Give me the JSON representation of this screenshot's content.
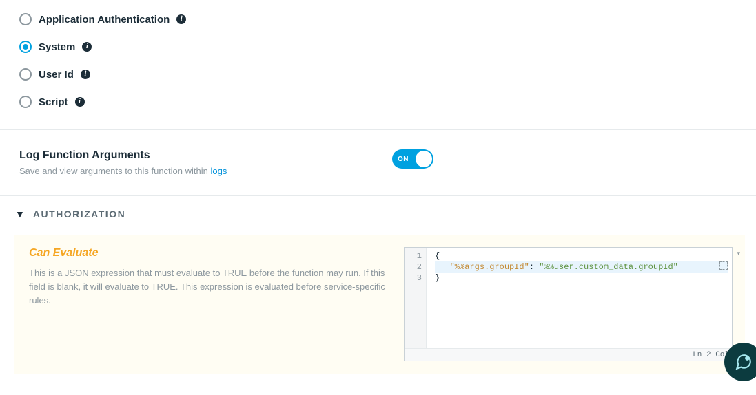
{
  "radios": {
    "items": [
      {
        "label": "Application Authentication",
        "selected": false
      },
      {
        "label": "System",
        "selected": true
      },
      {
        "label": "User Id",
        "selected": false
      },
      {
        "label": "Script",
        "selected": false
      }
    ]
  },
  "log_args": {
    "title": "Log Function Arguments",
    "desc_prefix": "Save and view arguments to this function within ",
    "link": "logs",
    "toggle_label": "ON",
    "enabled": true
  },
  "auth": {
    "header": "AUTHORIZATION",
    "panel_title": "Can Evaluate",
    "panel_desc": "This is a JSON expression that must evaluate to TRUE before the function may run. If this field is blank, it will evaluate to TRUE. This expression is evaluated before service-specific rules."
  },
  "editor": {
    "lines": {
      "l1_open": "{",
      "l2_key": "\"%%args.groupId\"",
      "l2_sep": ": ",
      "l2_val": "\"%%user.custom_data.groupId\"",
      "l3_close": "}"
    },
    "gutter": [
      "1",
      "2",
      "3"
    ],
    "status": "Ln 2 Col"
  }
}
